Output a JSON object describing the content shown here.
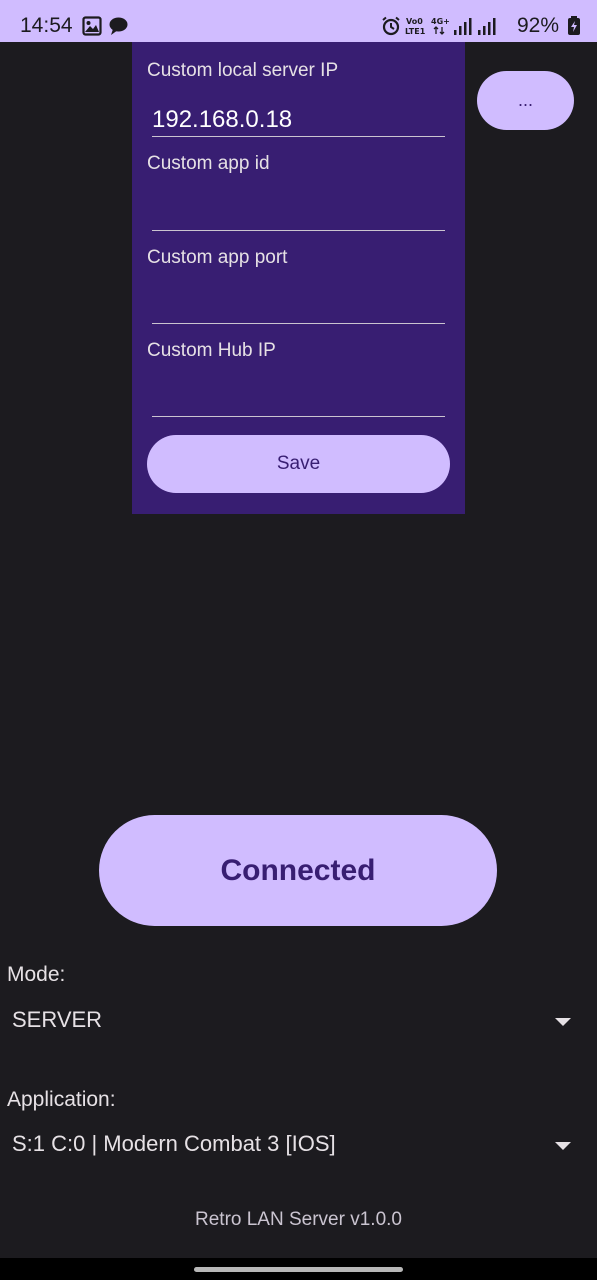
{
  "status_bar": {
    "time": "14:54",
    "battery_percent": "92%",
    "left_icons": [
      "image-icon",
      "chat-icon"
    ],
    "right_icons": [
      "alarm-icon",
      "volte-icon",
      "4g-icon",
      "signal-icon",
      "signal-icon",
      "battery-charging-icon"
    ],
    "network_label": "4G+",
    "volte_label": "Vo0 LTE1"
  },
  "settings": {
    "fields": [
      {
        "label": "Custom local server IP",
        "value": "192.168.0.18"
      },
      {
        "label": "Custom app id",
        "value": ""
      },
      {
        "label": "Custom app port",
        "value": ""
      },
      {
        "label": "Custom Hub IP",
        "value": ""
      }
    ],
    "save_label": "Save"
  },
  "more_button_label": "...",
  "connect_button_label": "Connected",
  "mode": {
    "label": "Mode:",
    "selected": "SERVER"
  },
  "application": {
    "label": "Application:",
    "selected": "S:1 C:0 | Modern Combat 3 [IOS]"
  },
  "footer": {
    "version": "Retro LAN Server v1.0.0"
  },
  "colors": {
    "status_bar": "#d0bcff",
    "background": "#1c1b1f",
    "card": "#381e72",
    "button": "#d0bcff",
    "button_text": "#381e72"
  }
}
